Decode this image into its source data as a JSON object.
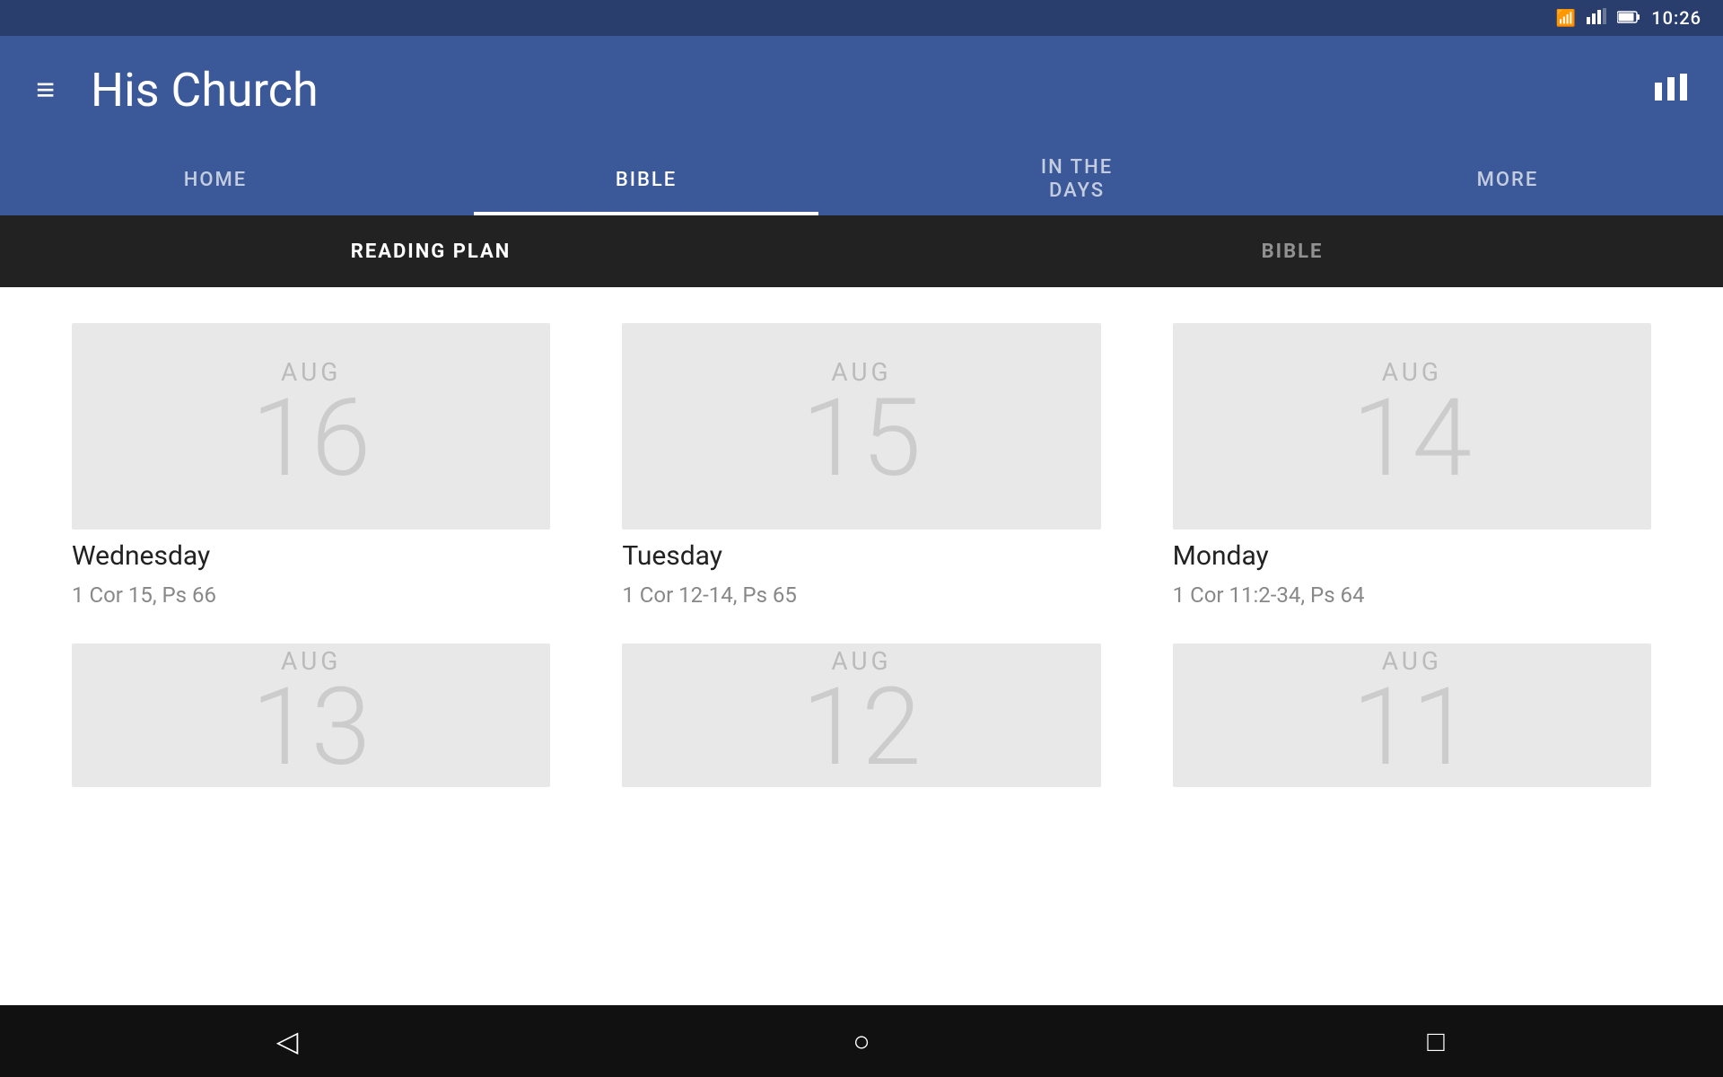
{
  "statusBar": {
    "time": "10:26",
    "wifiIcon": "wifi",
    "signalIcon": "signal",
    "batteryIcon": "battery"
  },
  "appBar": {
    "menuIcon": "≡",
    "title": "His Church",
    "chartIcon": "chart"
  },
  "navTabs": [
    {
      "id": "home",
      "label": "HOME",
      "active": false
    },
    {
      "id": "bible",
      "label": "BIBLE",
      "active": true
    },
    {
      "id": "inthedays",
      "label": "IN THE\nDAYS",
      "active": false
    },
    {
      "id": "more",
      "label": "MORE",
      "active": false
    }
  ],
  "subTabs": [
    {
      "id": "reading-plan",
      "label": "READING PLAN",
      "active": true
    },
    {
      "id": "bible",
      "label": "BIBLE",
      "active": false
    }
  ],
  "cards": [
    {
      "id": "aug16",
      "month": "AUG",
      "day": "16",
      "dayName": "Wednesday",
      "reading": "1 Cor 15, Ps 66"
    },
    {
      "id": "aug15",
      "month": "AUG",
      "day": "15",
      "dayName": "Tuesday",
      "reading": "1 Cor 12-14, Ps 65"
    },
    {
      "id": "aug14",
      "month": "AUG",
      "day": "14",
      "dayName": "Monday",
      "reading": "1 Cor 11:2-34, Ps 64"
    },
    {
      "id": "aug13",
      "month": "AUG",
      "day": "13",
      "dayName": "",
      "reading": ""
    },
    {
      "id": "aug12",
      "month": "AUG",
      "day": "12",
      "dayName": "",
      "reading": ""
    },
    {
      "id": "aug11",
      "month": "AUG",
      "day": "11",
      "dayName": "",
      "reading": ""
    }
  ],
  "bottomNav": {
    "backIcon": "◁",
    "homeIcon": "○",
    "squareIcon": "□"
  },
  "colors": {
    "appBarBg": "#3b5998",
    "statusBarBg": "#2a3e6e",
    "subTabsBg": "#222",
    "cardBg": "#e8e8e8",
    "activeTabLine": "#ffffff"
  }
}
